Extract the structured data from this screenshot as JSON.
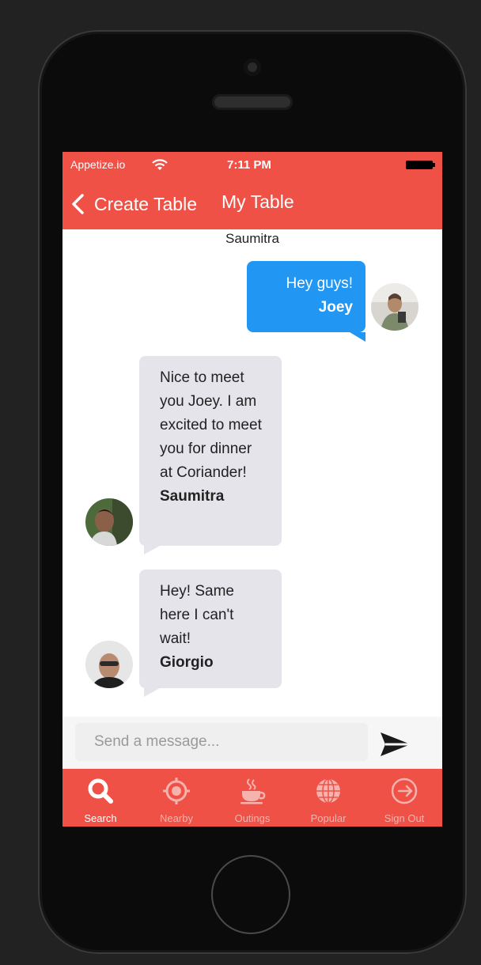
{
  "colors": {
    "brand": "#ef5147",
    "outgoing_bubble": "#2196f3",
    "incoming_bubble": "#e4e4ea",
    "tab_active": "#ffffff",
    "tab_inactive": "#f6b3ad"
  },
  "status_bar": {
    "carrier": "Appetize.io",
    "time": "7:11 PM",
    "wifi_icon": "wifi-icon",
    "battery_icon": "battery-icon"
  },
  "nav_bar": {
    "back_label": "Create Table",
    "title": "My Table",
    "back_icon": "chevron-left-icon"
  },
  "chat": {
    "table_member": "Saumitra",
    "messages": [
      {
        "direction": "outgoing",
        "text": "Hey guys!",
        "author": "Joey"
      },
      {
        "direction": "incoming",
        "text": "Nice to meet you Joey. I am excited to meet you for dinner at Coriander!",
        "author": "Saumitra"
      },
      {
        "direction": "incoming",
        "text": "Hey! Same here I can't wait!",
        "author": "Giorgio"
      }
    ]
  },
  "composer": {
    "placeholder": "Send a message...",
    "value": "",
    "send_icon": "send-icon"
  },
  "tabs": [
    {
      "label": "Search",
      "icon": "search-icon",
      "active": true
    },
    {
      "label": "Nearby",
      "icon": "target-icon",
      "active": false
    },
    {
      "label": "Outings",
      "icon": "coffee-cup-icon",
      "active": false
    },
    {
      "label": "Popular",
      "icon": "globe-icon",
      "active": false
    },
    {
      "label": "Sign Out",
      "icon": "sign-out-icon",
      "active": false
    }
  ]
}
